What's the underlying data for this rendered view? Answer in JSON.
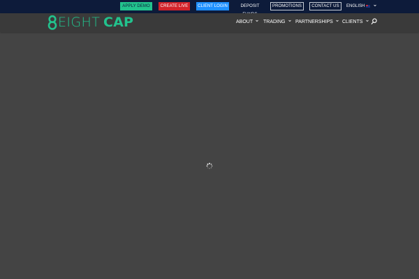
{
  "topbar": {
    "apply_demo": "APPLY DEMO",
    "create_live": "CREATE LIVE",
    "client_login": "CLIENT LOGIN",
    "deposit_funds": "DEPOSIT FUNDS",
    "promotions": "PROMOTIONS",
    "contact_us": "CONTACT US",
    "language": "ENGLISH",
    "flag_icon": "australia-flag-icon"
  },
  "logo": {
    "eight": "EIGHT",
    "cap": "CAP"
  },
  "nav": {
    "items": [
      {
        "label": "ABOUT"
      },
      {
        "label": "TRADING"
      },
      {
        "label": "PARTNERSHIPS"
      },
      {
        "label": "CLIENTS"
      }
    ],
    "search_icon": "search-icon"
  },
  "colors": {
    "topbar_bg": "#0d1b3a",
    "navbar_bg": "#3a3a3a",
    "page_bg": "#444444",
    "brand_green": "#22c28d",
    "live_red": "#d2232a",
    "login_blue": "#1e90ff"
  },
  "loading_icon": "loading-spinner-icon"
}
